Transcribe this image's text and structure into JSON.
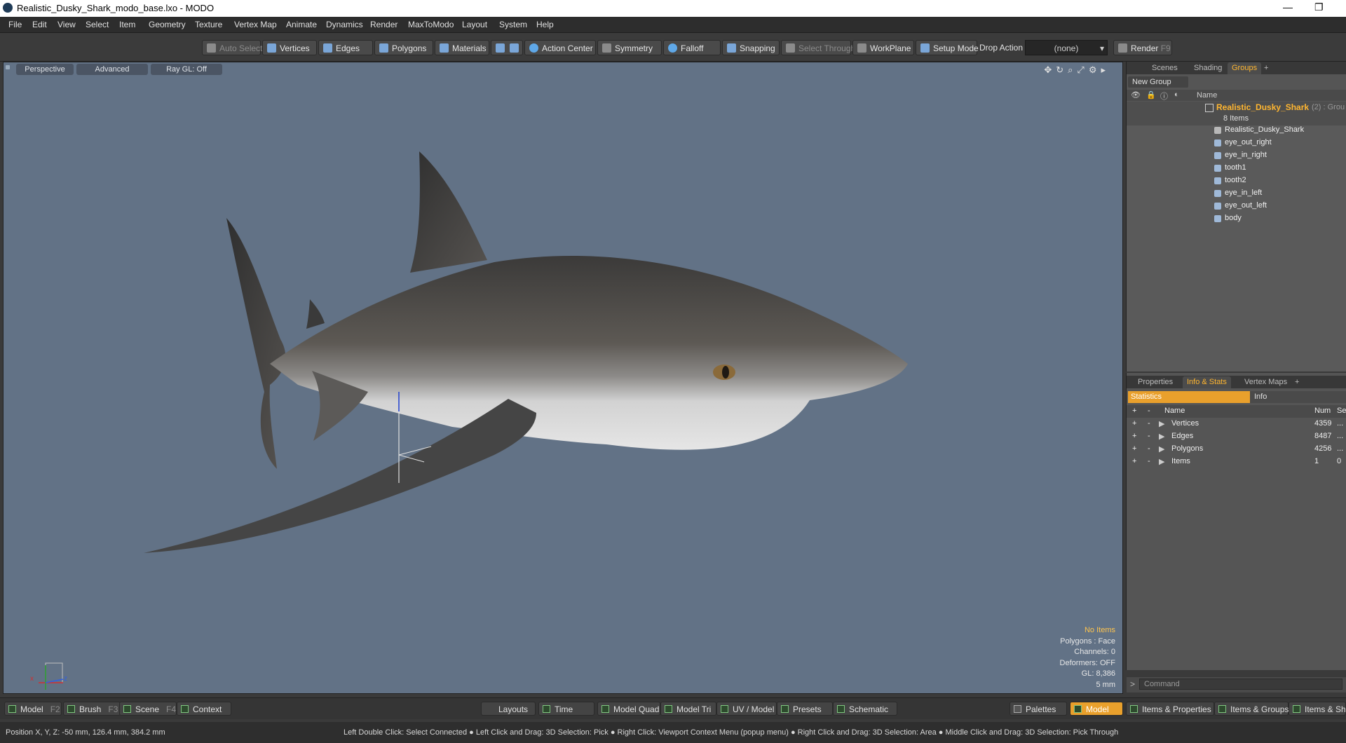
{
  "window": {
    "title": "Realistic_Dusky_Shark_modo_base.lxo - MODO"
  },
  "menu": [
    "File",
    "Edit",
    "View",
    "Select",
    "Item",
    "Geometry",
    "Texture",
    "Vertex Map",
    "Animate",
    "Dynamics",
    "Render",
    "MaxToModo",
    "Layout",
    "System",
    "Help"
  ],
  "toolbar": {
    "auto_select": "Auto Select",
    "vertices": "Vertices",
    "edges": "Edges",
    "polygons": "Polygons",
    "materials": "Materials",
    "action_center": "Action Center",
    "symmetry": "Symmetry",
    "falloff": "Falloff",
    "snapping": "Snapping",
    "select_through": "Select Through",
    "workplane": "WorkPlane",
    "setup_mode": "Setup Mode",
    "drop_action_label": "Drop Action",
    "drop_action_value": "(none)",
    "render": "Render",
    "render_key": "F9"
  },
  "viewport": {
    "tabs": [
      "Perspective",
      "Advanced",
      "Ray GL: Off"
    ],
    "stats": {
      "items": "No Items",
      "polygons": "Polygons : Face",
      "channels": "Channels: 0",
      "deformers": "Deformers: OFF",
      "gl": "GL: 8,386",
      "scale": "5 mm"
    },
    "axis_labels": {
      "x": "x",
      "z": "z"
    }
  },
  "groups_panel": {
    "tabs": [
      "Scenes",
      "Shading",
      "Groups"
    ],
    "active_tab": "Groups",
    "new_group": "New Group",
    "name_header": "Name",
    "group_name": "Realistic_Dusky_Shark",
    "group_suffix": "(2) : Grou",
    "item_count": "8 Items",
    "items": [
      "Realistic_Dusky_Shark",
      "eye_out_right",
      "eye_in_right",
      "tooth1",
      "tooth2",
      "eye_in_left",
      "eye_out_left",
      "body"
    ]
  },
  "info_panel": {
    "tabs": [
      "Properties",
      "Info & Stats",
      "Vertex Maps"
    ],
    "active_tab": "Info & Stats",
    "sub_tabs": [
      "Statistics",
      "Info"
    ],
    "headers": {
      "name": "Name",
      "num": "Num",
      "sel": "Sel"
    },
    "rows": [
      {
        "name": "Vertices",
        "num": "4359",
        "sel": "..."
      },
      {
        "name": "Edges",
        "num": "8487",
        "sel": "..."
      },
      {
        "name": "Polygons",
        "num": "4256",
        "sel": "..."
      },
      {
        "name": "Items",
        "num": "1",
        "sel": "0"
      }
    ],
    "command_placeholder": "Command"
  },
  "bottom_left": [
    {
      "label": "Model",
      "key": "F2"
    },
    {
      "label": "Brush",
      "key": "F3"
    },
    {
      "label": "Scene",
      "key": "F4"
    },
    {
      "label": "Context",
      "key": ""
    }
  ],
  "bottom_center": [
    "Layouts",
    "Time",
    "Model Quad",
    "Model Tri",
    "UV / Model",
    "Presets",
    "Schematic"
  ],
  "bottom_right": [
    "Palettes",
    "Model",
    "Items & Properties",
    "Items & Groups",
    "Items & Sha"
  ],
  "status": {
    "position": "Position X, Y, Z:  -50 mm, 126.4 mm, 384.2 mm",
    "hints": "Left Double Click: Select Connected ● Left Click and Drag: 3D Selection: Pick ● Right Click: Viewport Context Menu (popup menu) ● Right Click and Drag: 3D Selection: Area ● Middle Click and Drag: 3D Selection: Pick Through"
  },
  "colors": {
    "accent": "#e9a02c",
    "viewport_bg": "#627286",
    "group_title": "#ffb630"
  }
}
